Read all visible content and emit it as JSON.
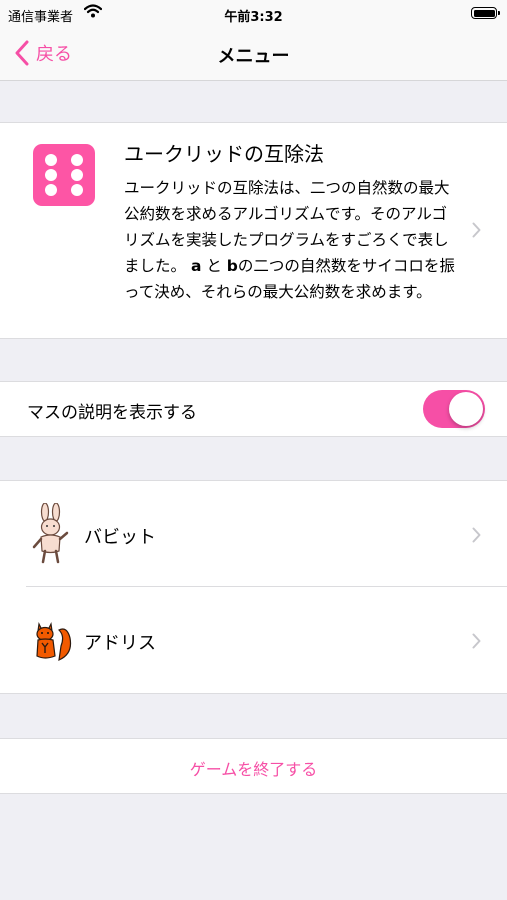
{
  "status_bar": {
    "carrier": "通信事業者",
    "time": "午前3:32"
  },
  "nav": {
    "back_label": "戻る",
    "title": "メニュー"
  },
  "about": {
    "title": "ユークリッドの互除法",
    "desc_1": "ユークリッドの互除法は、二つの自然数の最大公約数を求めるアルゴリズムです。そのアルゴリズムを実装したプログラムをすごろくで表しました。 ",
    "var_a": "a",
    "desc_2": " と ",
    "var_b": "b",
    "desc_3": "の二つの自然数をサイコロを振って決め、それらの最大公約数を求めます。",
    "accent_color": "#fd55a5"
  },
  "settings": {
    "show_square_desc_label": "マスの説明を表示する",
    "show_square_desc_on": true,
    "toggle_color": "#f64fa6"
  },
  "characters": [
    {
      "name": "バビット",
      "icon": "rabbit-character-icon"
    },
    {
      "name": "アドリス",
      "icon": "squirrel-character-icon"
    }
  ],
  "quit_label": "ゲームを終了する"
}
